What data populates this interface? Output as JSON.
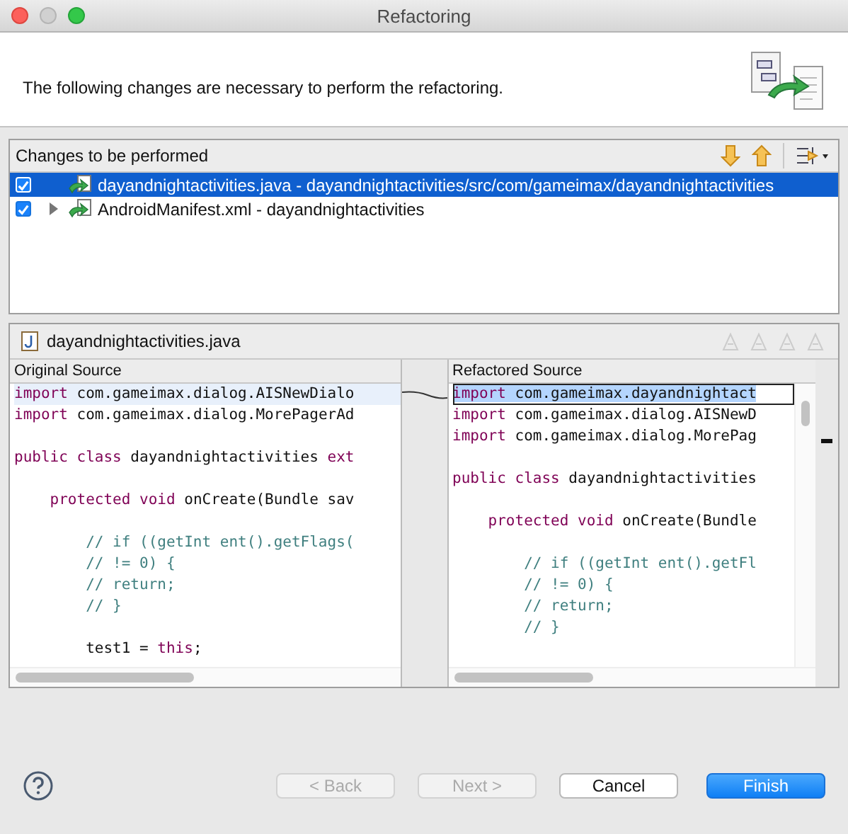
{
  "window": {
    "title": "Refactoring"
  },
  "header": {
    "message": "The following changes are necessary to perform the refactoring."
  },
  "changes": {
    "title": "Changes to be performed",
    "items": [
      {
        "label": "dayandnightactivities.java - dayandnightactivities/src/com/gameimax/dayandnightactivities",
        "checked": true,
        "selected": true,
        "expandable": false
      },
      {
        "label": "AndroidManifest.xml - dayandnightactivities",
        "checked": true,
        "selected": false,
        "expandable": true
      }
    ]
  },
  "preview": {
    "file": "dayandnightactivities.java",
    "original": {
      "title": "Original Source",
      "lines": [
        {
          "highlighted": true,
          "selected": false,
          "tokens": [
            {
              "kind": "keyword",
              "text": "import"
            },
            {
              "kind": "plain",
              "text": " com.gameimax.dialog.AISNewDialo"
            }
          ]
        },
        {
          "highlighted": false,
          "selected": false,
          "tokens": [
            {
              "kind": "keyword",
              "text": "import"
            },
            {
              "kind": "plain",
              "text": " com.gameimax.dialog.MorePagerAd"
            }
          ]
        },
        {
          "highlighted": false,
          "selected": false
        },
        {
          "highlighted": false,
          "selected": false,
          "tokens": [
            {
              "kind": "keyword",
              "text": "public class"
            },
            {
              "kind": "plain",
              "text": " dayandnightactivities "
            },
            {
              "kind": "keyword",
              "text": "ext"
            }
          ]
        },
        {
          "highlighted": false,
          "selected": false
        },
        {
          "highlighted": false,
          "selected": false,
          "tokens": [
            {
              "kind": "keyword",
              "text": "    protected void"
            },
            {
              "kind": "plain",
              "text": " onCreate(Bundle sav"
            }
          ]
        },
        {
          "highlighted": false,
          "selected": false
        },
        {
          "highlighted": false,
          "selected": false,
          "tokens": [
            {
              "kind": "comment",
              "text": "        // if ((getInt ent().getFlags("
            }
          ]
        },
        {
          "highlighted": false,
          "selected": false,
          "tokens": [
            {
              "kind": "comment",
              "text": "        // != 0) {"
            }
          ]
        },
        {
          "highlighted": false,
          "selected": false,
          "tokens": [
            {
              "kind": "comment",
              "text": "        // return;"
            }
          ]
        },
        {
          "highlighted": false,
          "selected": false,
          "tokens": [
            {
              "kind": "comment",
              "text": "        // }"
            }
          ]
        },
        {
          "highlighted": false,
          "selected": false
        },
        {
          "highlighted": false,
          "selected": false,
          "tokens": [
            {
              "kind": "plain",
              "text": "        test1 = "
            },
            {
              "kind": "keyword",
              "text": "this"
            },
            {
              "kind": "plain",
              "text": ";"
            }
          ]
        }
      ]
    },
    "refactored": {
      "title": "Refactored Source",
      "lines": [
        {
          "highlighted": false,
          "selected": true,
          "tokens": [
            {
              "kind": "keyword",
              "text": "import"
            },
            {
              "kind": "plain",
              "text": " com.gameimax.dayandnightact"
            }
          ]
        },
        {
          "highlighted": false,
          "selected": false,
          "tokens": [
            {
              "kind": "keyword",
              "text": "import"
            },
            {
              "kind": "plain",
              "text": " com.gameimax.dialog.AISNewD"
            }
          ]
        },
        {
          "highlighted": false,
          "selected": false,
          "tokens": [
            {
              "kind": "keyword",
              "text": "import"
            },
            {
              "kind": "plain",
              "text": " com.gameimax.dialog.MorePag"
            }
          ]
        },
        {
          "highlighted": false,
          "selected": false
        },
        {
          "highlighted": false,
          "selected": false,
          "tokens": [
            {
              "kind": "keyword",
              "text": "public class"
            },
            {
              "kind": "plain",
              "text": " dayandnightactivities"
            }
          ]
        },
        {
          "highlighted": false,
          "selected": false
        },
        {
          "highlighted": false,
          "selected": false,
          "tokens": [
            {
              "kind": "keyword",
              "text": "    protected void"
            },
            {
              "kind": "plain",
              "text": " onCreate(Bundle"
            }
          ]
        },
        {
          "highlighted": false,
          "selected": false
        },
        {
          "highlighted": false,
          "selected": false,
          "tokens": [
            {
              "kind": "comment",
              "text": "        // if ((getInt ent().getFl"
            }
          ]
        },
        {
          "highlighted": false,
          "selected": false,
          "tokens": [
            {
              "kind": "comment",
              "text": "        // != 0) {"
            }
          ]
        },
        {
          "highlighted": false,
          "selected": false,
          "tokens": [
            {
              "kind": "comment",
              "text": "        // return;"
            }
          ]
        },
        {
          "highlighted": false,
          "selected": false,
          "tokens": [
            {
              "kind": "comment",
              "text": "        // }"
            }
          ]
        }
      ]
    }
  },
  "buttons": [
    {
      "label": "< Back",
      "disabled": true,
      "default": false
    },
    {
      "label": "Next >",
      "disabled": true,
      "default": false
    },
    {
      "label": "Cancel",
      "disabled": false,
      "default": false
    },
    {
      "label": "Finish",
      "disabled": false,
      "default": true
    }
  ]
}
